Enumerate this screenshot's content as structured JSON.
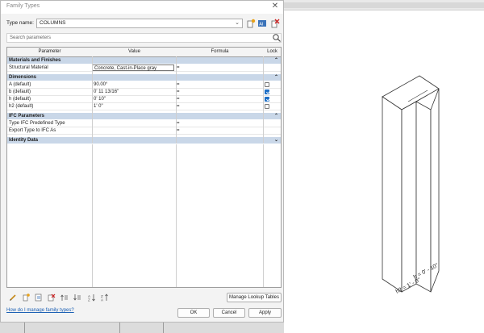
{
  "dialog": {
    "title": "Family Types",
    "close_glyph": "✕",
    "type_name_label": "Type name:",
    "type_name_value": "COLUMNS",
    "search_placeholder": "Search parameters"
  },
  "grid": {
    "columns": [
      "Parameter",
      "Value",
      "Formula",
      "Lock"
    ],
    "groups": [
      {
        "label": "Materials and Finishes",
        "toggle": "⌃",
        "rows": [
          {
            "parameter": "Structural Material",
            "value": "Concrete, Cast-in-Place gray",
            "formula": "=",
            "lock": null
          }
        ]
      },
      {
        "label": "Dimensions",
        "toggle": "⌃",
        "rows": [
          {
            "parameter": "A (default)",
            "value": "90.00°",
            "formula": "=",
            "lock": false
          },
          {
            "parameter": "b (default)",
            "value": "0'  11 13/16\"",
            "formula": "=",
            "lock": true
          },
          {
            "parameter": "h (default)",
            "value": "0'  10\"",
            "formula": "=",
            "lock": true
          },
          {
            "parameter": "h2 (default)",
            "value": "1'  0\"",
            "formula": "=",
            "lock": false
          }
        ]
      },
      {
        "label": "IFC Parameters",
        "toggle": "⌃",
        "rows": [
          {
            "parameter": "Type IFC Predefined Type",
            "value": "",
            "formula": "=",
            "lock": null
          },
          {
            "parameter": "Export Type to IFC As",
            "value": "",
            "formula": "=",
            "lock": null
          }
        ]
      },
      {
        "label": "Identity Data",
        "toggle": "⌄",
        "rows": []
      }
    ]
  },
  "buttons": {
    "manage_lookup": "Manage Lookup Tables",
    "ok": "OK",
    "cancel": "Cancel",
    "apply": "Apply"
  },
  "help_link": "How do I manage family types?",
  "model_labels": {
    "h": "h = 0' - 10\"",
    "h2": "h2 = 1' - 0\""
  },
  "colors": {
    "group_header": "#c9d7e8",
    "checkbox_checked": "#1e6fc6",
    "link": "#1a5fb4"
  }
}
